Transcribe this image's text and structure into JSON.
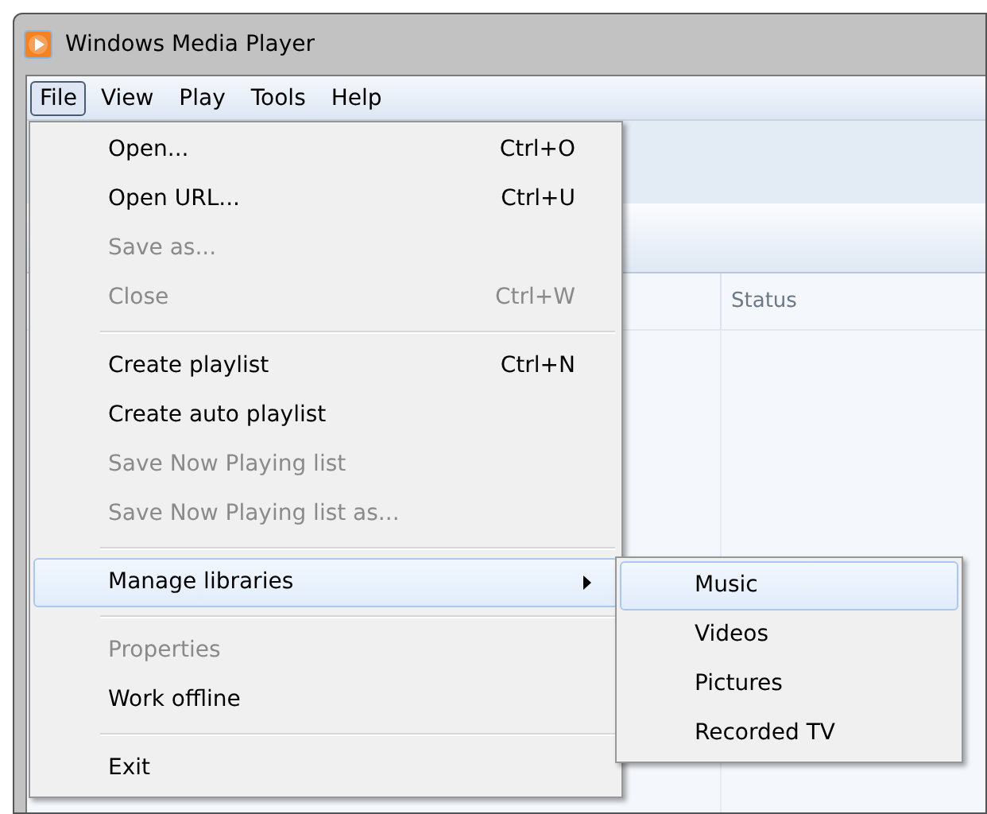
{
  "window": {
    "title": "Windows Media Player"
  },
  "menu_bar": [
    {
      "label": "File",
      "selected": true
    },
    {
      "label": "View",
      "selected": false
    },
    {
      "label": "Play",
      "selected": false
    },
    {
      "label": "Tools",
      "selected": false
    },
    {
      "label": "Help",
      "selected": false
    }
  ],
  "file_menu": {
    "items": [
      {
        "kind": "item",
        "label": "Open...",
        "shortcut": "Ctrl+O",
        "disabled": false,
        "selected": false,
        "submenu": false
      },
      {
        "kind": "item",
        "label": "Open URL...",
        "shortcut": "Ctrl+U",
        "disabled": false,
        "selected": false,
        "submenu": false
      },
      {
        "kind": "item",
        "label": "Save as...",
        "disabled": true,
        "selected": false,
        "submenu": false
      },
      {
        "kind": "item",
        "label": "Close",
        "shortcut": "Ctrl+W",
        "disabled": true,
        "selected": false,
        "submenu": false
      },
      {
        "kind": "separator"
      },
      {
        "kind": "item",
        "label": "Create playlist",
        "shortcut": "Ctrl+N",
        "disabled": false,
        "selected": false,
        "submenu": false
      },
      {
        "kind": "item",
        "label": "Create auto playlist",
        "disabled": false,
        "selected": false,
        "submenu": false
      },
      {
        "kind": "item",
        "label": "Save Now Playing list",
        "disabled": true,
        "selected": false,
        "submenu": false
      },
      {
        "kind": "item",
        "label": "Save Now Playing list as...",
        "disabled": true,
        "selected": false,
        "submenu": false
      },
      {
        "kind": "separator"
      },
      {
        "kind": "item",
        "label": "Manage libraries",
        "disabled": false,
        "selected": true,
        "submenu": true
      },
      {
        "kind": "separator"
      },
      {
        "kind": "item",
        "label": "Properties",
        "disabled": true,
        "selected": false,
        "submenu": false
      },
      {
        "kind": "item",
        "label": "Work offline",
        "disabled": false,
        "selected": false,
        "submenu": false
      },
      {
        "kind": "separator"
      },
      {
        "kind": "item",
        "label": "Exit",
        "disabled": false,
        "selected": false,
        "submenu": false
      }
    ]
  },
  "submenu": {
    "items": [
      {
        "label": "Music",
        "selected": true
      },
      {
        "label": "Videos",
        "selected": false
      },
      {
        "label": "Pictures",
        "selected": false
      },
      {
        "label": "Recorded TV",
        "selected": false
      }
    ]
  },
  "table": {
    "columns": [
      {
        "label": "Status"
      }
    ]
  }
}
